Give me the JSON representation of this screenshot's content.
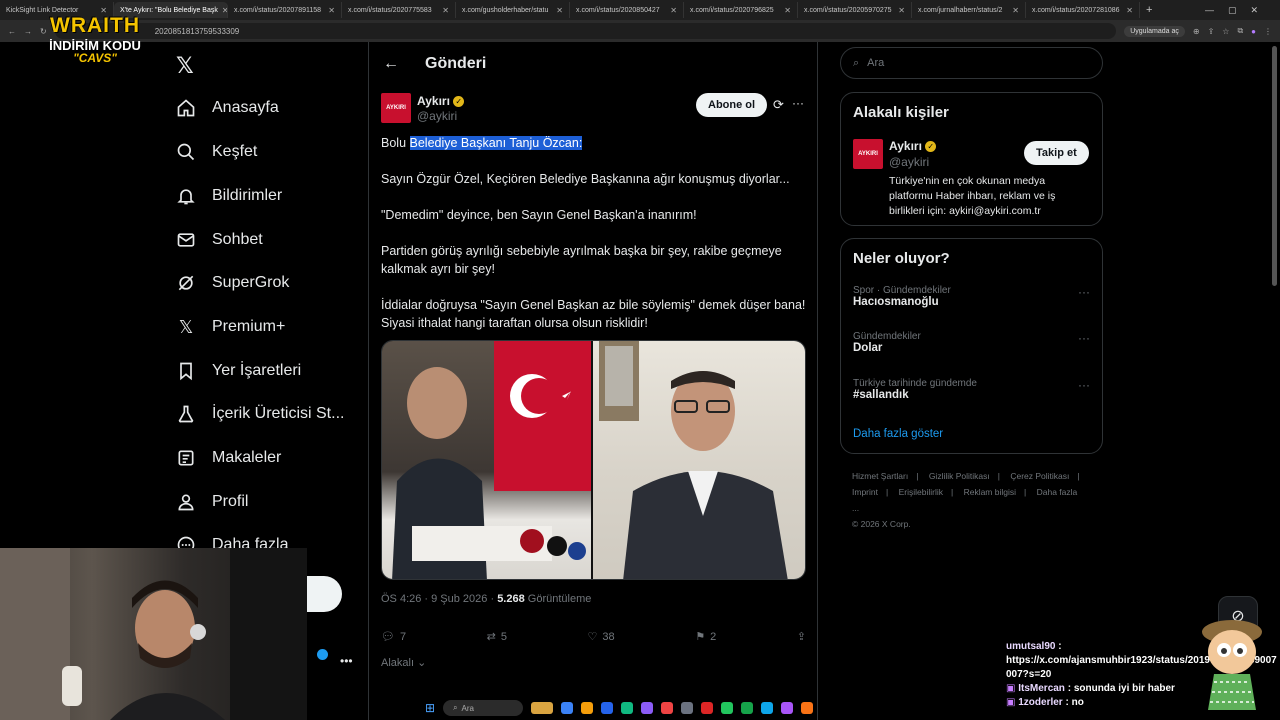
{
  "browser": {
    "tabs": [
      {
        "title": "KickSight Link Detector",
        "active": false
      },
      {
        "title": "X'te Aykırı: \"Bolu Belediye Başk",
        "active": true
      },
      {
        "title": "x.com/i/status/20207891158",
        "active": false
      },
      {
        "title": "x.com/i/status/2020775583",
        "active": false
      },
      {
        "title": "x.com/gusholderhaber/statu",
        "active": false
      },
      {
        "title": "x.com/i/status/2020850427",
        "active": false
      },
      {
        "title": "x.com/i/status/2020796825",
        "active": false
      },
      {
        "title": "x.com/i/status/20205970275",
        "active": false
      },
      {
        "title": "x.com/jurnalhaberr/status/2",
        "active": false
      },
      {
        "title": "x.com/i/status/20207281086",
        "active": false
      }
    ],
    "url": "2020851813759533309",
    "apps_pill": "Uygulamada aç"
  },
  "overlay": {
    "brand": "WRAITH",
    "promo_line1": "İNDİRİM KODU",
    "promo_code": "\"CAVS\""
  },
  "nav": {
    "items": [
      {
        "label": "Anasayfa",
        "icon": "home-icon"
      },
      {
        "label": "Keşfet",
        "icon": "search-icon"
      },
      {
        "label": "Bildirimler",
        "icon": "bell-icon"
      },
      {
        "label": "Sohbet",
        "icon": "mail-icon"
      },
      {
        "label": "SuperGrok",
        "icon": "grok-icon"
      },
      {
        "label": "Premium+",
        "icon": "x-icon"
      },
      {
        "label": "Yer İşaretleri",
        "icon": "bookmark-icon"
      },
      {
        "label": "İçerik Üreticisi St...",
        "icon": "creator-icon"
      },
      {
        "label": "Makaleler",
        "icon": "article-icon"
      },
      {
        "label": "Profil",
        "icon": "profile-icon"
      },
      {
        "label": "Daha fazla",
        "icon": "more-icon"
      }
    ]
  },
  "post": {
    "header_title": "Gönderi",
    "author_name": "Aykırı",
    "author_handle": "@aykiri",
    "avatar_text": "AYKIRI",
    "subscribe_label": "Abone ol",
    "text_prefix": "Bolu ",
    "text_highlight": "Belediye Başkanı Tanju Özcan:",
    "paragraphs": [
      "Sayın Özgür Özel, Keçiören Belediye Başkanına ağır konuşmuş diyorlar...",
      "\"Demedim\" deyince, ben Sayın Genel Başkan'a inanırım!",
      "Partiden görüş ayrılığı sebebiyle ayrılmak başka bir şey, rakibe geçmeye kalkmak ayrı bir şey!",
      "İddialar doğruysa \"Sayın Genel Başkan az bile söylemiş\" demek düşer bana! Siyasi ithalat hangi taraftan olursa olsun risklidir!"
    ],
    "time": "ÖS 4:26 · 9 Şub 2026 · ",
    "views": "5.268",
    "views_label": " Görüntüleme",
    "replies": "7",
    "reposts": "5",
    "likes": "38",
    "bookmarks": "2",
    "sort_label": "Alakalı"
  },
  "right": {
    "search_placeholder": "Ara",
    "related_title": "Alakalı kişiler",
    "related": {
      "name": "Aykırı",
      "handle": "@aykiri",
      "follow_label": "Takip et",
      "bio": "Türkiye'nin en çok okunan medya platformu Haber ihbarı, reklam ve iş birlikleri için: aykiri@aykiri.com.tr"
    },
    "trends_title": "Neler oluyor?",
    "trends": [
      {
        "category": "Spor · Gündemdekiler",
        "name": "Hacıosmanoğlu"
      },
      {
        "category": "Gündemdekiler",
        "name": "Dolar"
      },
      {
        "category": "Türkiye tarihinde gündemde",
        "name": "#sallandık"
      }
    ],
    "show_more": "Daha fazla göster",
    "footer_links": [
      "Hizmet Şartları",
      "Gizlilik Politikası",
      "Çerez Politikası",
      "Imprint",
      "Erişilebilirlik",
      "Reklam bilgisi",
      "Daha fazla ..."
    ],
    "copyright": "© 2026 X Corp."
  },
  "chat": {
    "lines": [
      {
        "user": "umutsal90",
        "text": "https://x.com/ajansmuhbir1923/status/2019794761759007007?s=20"
      },
      {
        "user": "ItsMercan",
        "text": "sonunda iyi bir haber"
      },
      {
        "user": "1zoderler",
        "text": "no"
      }
    ]
  },
  "taskbar": {
    "search_label": "Ara"
  },
  "colors": {
    "accent": "#1d9bf0",
    "verified_gold": "#e2b719",
    "brand_yellow": "#f5c400"
  }
}
